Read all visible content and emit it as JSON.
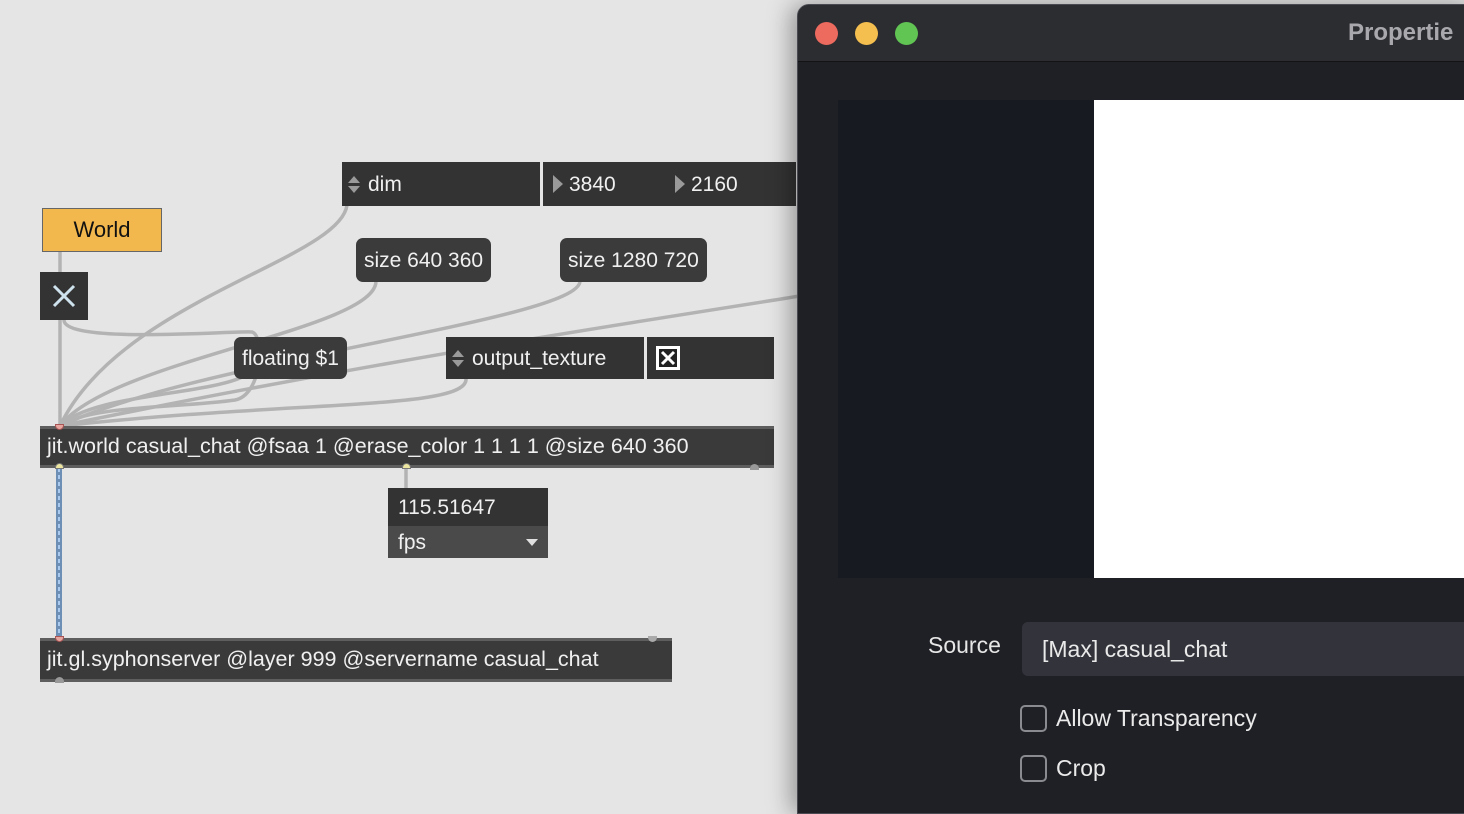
{
  "patcher": {
    "world_button_label": "World",
    "dim_message": "dim",
    "dim_width": "3840",
    "dim_height": "2160",
    "size_small": "size 640 360",
    "size_large": "size 1280 720",
    "floating_message": "floating $1",
    "output_texture_message": "output_texture",
    "world_object": "jit.world casual_chat @fsaa 1 @erase_color 1 1 1 1 @size 640 360",
    "fps_value": "115.51647",
    "fps_mode": "fps",
    "syphon_object": "jit.gl.syphonserver @layer 999 @servername casual_chat",
    "toggle_close_icon": "x-icon",
    "output_toggle_icon": "checked-x-icon"
  },
  "properties_window": {
    "title": "Propertie",
    "source_label": "Source",
    "source_value": "[Max] casual_chat",
    "allow_transparency_label": "Allow Transparency",
    "crop_label": "Crop",
    "traffic_lights": {
      "close": "#ec6a5e",
      "minimize": "#f4bf4f",
      "zoom": "#61c554"
    }
  },
  "colors": {
    "canvas_bg": "#e5e5e5",
    "world_button": "#f2b84e",
    "object_bg": "#333333",
    "patch_cable": "#b5b5b5",
    "matrix_cable": "#5b9bd5"
  }
}
